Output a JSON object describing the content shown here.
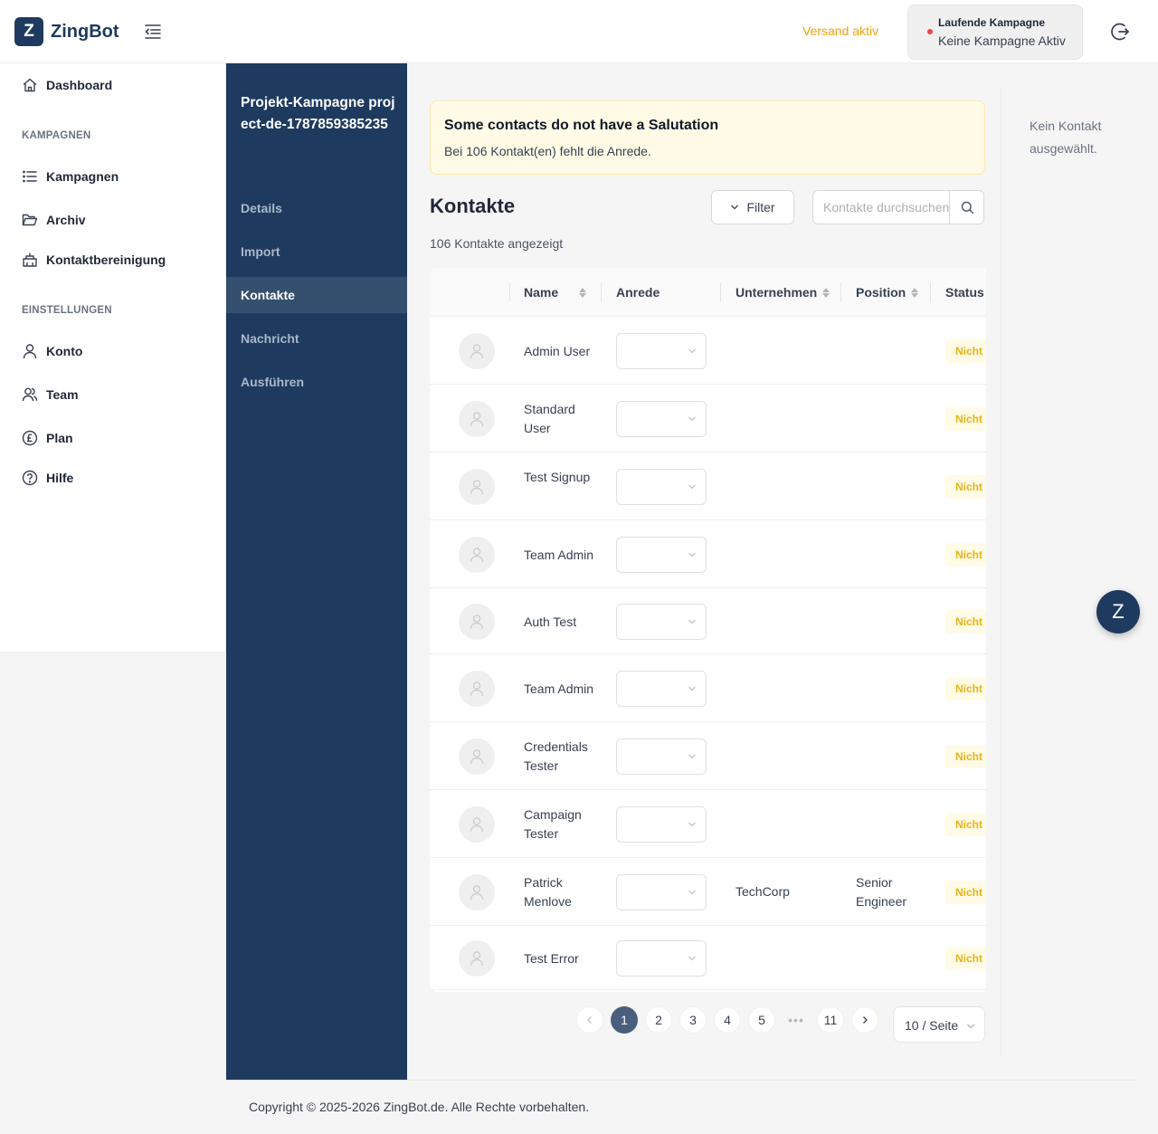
{
  "header": {
    "logo_letter": "Z",
    "app_name": "ZingBot",
    "send_status": "Versand aktiv",
    "campaign_label": "Laufende Kampagne",
    "campaign_value": "Keine Kampagne Aktiv",
    "accent_color": "#f0a30a",
    "brand_color": "#1e3a5f"
  },
  "sidebar": {
    "dashboard": "Dashboard",
    "section_campaigns": "KAMPAGNEN",
    "campaigns": "Kampagnen",
    "archive": "Archiv",
    "contact_cleanup": "Kontaktbereinigung",
    "section_settings": "EINSTELLUNGEN",
    "account": "Konto",
    "team": "Team",
    "plan": "Plan",
    "help": "Hilfe"
  },
  "campaign_nav": {
    "title": "Projekt-Kampagne project-de-1787859385235",
    "items": [
      "Details",
      "Import",
      "Kontakte",
      "Nachricht",
      "Ausführen"
    ],
    "active": "Kontakte"
  },
  "alert": {
    "title": "Some contacts do not have a Salutation",
    "description": "Bei 106 Kontakt(en) fehlt die Anrede."
  },
  "contacts": {
    "title": "Kontakte",
    "filter_label": "Filter",
    "search_placeholder": "Kontakte durchsuchen",
    "count_text": "106 Kontakte angezeigt",
    "columns": {
      "name": "Name",
      "salutation": "Anrede",
      "company": "Unternehmen",
      "position": "Position",
      "status": "Status"
    },
    "rows": [
      {
        "name": "Admin User",
        "company": "",
        "position": "",
        "status": "Nicht bearbeitet"
      },
      {
        "name": "Standard User",
        "company": "",
        "position": "",
        "status": "Nicht bearbeitet"
      },
      {
        "name": "Test Signup",
        "company": "",
        "position": "",
        "status": "Nicht bearbeitet"
      },
      {
        "name": "Team Admin",
        "company": "",
        "position": "",
        "status": "Nicht bearbeitet"
      },
      {
        "name": "Auth Test",
        "company": "",
        "position": "",
        "status": "Nicht bearbeitet"
      },
      {
        "name": "Team Admin",
        "company": "",
        "position": "",
        "status": "Nicht bearbeitet"
      },
      {
        "name": "Credentials Tester",
        "company": "",
        "position": "",
        "status": "Nicht bearbeitet"
      },
      {
        "name": "Campaign Tester",
        "company": "",
        "position": "",
        "status": "Nicht bearbeitet"
      },
      {
        "name": "Patrick Menlove",
        "company": "TechCorp",
        "position": "Senior Engineer",
        "status": "Nicht bearbeitet"
      },
      {
        "name": "Test Error",
        "company": "",
        "position": "",
        "status": "Nicht bearbeitet"
      }
    ]
  },
  "pagination": {
    "pages": [
      "1",
      "2",
      "3",
      "4",
      "5"
    ],
    "ellipsis": "•••",
    "last_page": "11",
    "current": "1",
    "page_size": "10 / Seite"
  },
  "detail": {
    "empty_text": "Kein Kontakt ausgewählt."
  },
  "fab_letter": "Z",
  "footer": {
    "copyright": "Copyright © 2025-2026 ZingBot.de. Alle Rechte vorbehalten."
  }
}
